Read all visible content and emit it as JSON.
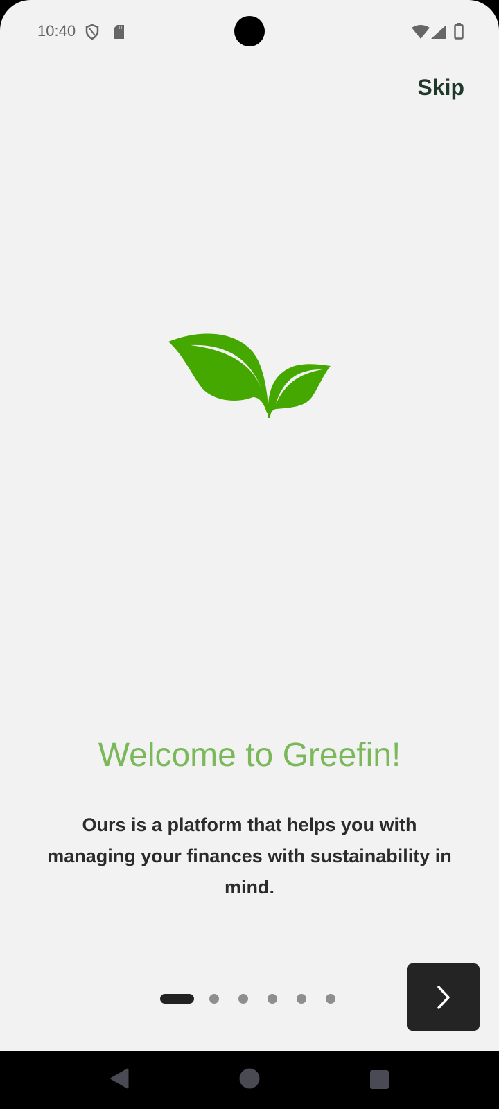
{
  "status_bar": {
    "time": "10:40",
    "icons": [
      "shield-icon",
      "sd-card-icon",
      "wifi-icon",
      "signal-icon",
      "battery-icon"
    ]
  },
  "header": {
    "skip_label": "Skip"
  },
  "onboarding": {
    "logo": "leaf-logo",
    "title": "Welcome to Greefin!",
    "description": "Ours is a platform that helps you with managing your finances with sustainability in mind.",
    "page_count": 6,
    "current_page": 1
  },
  "colors": {
    "accent": "#7ab85a",
    "leaf": "#44a800",
    "button": "#242424"
  },
  "nav_bar": {
    "icons": [
      "back-icon",
      "home-icon",
      "recents-icon"
    ]
  }
}
